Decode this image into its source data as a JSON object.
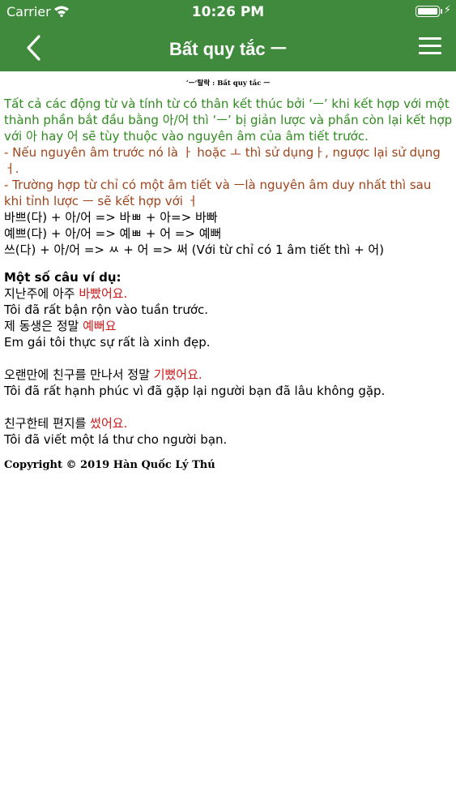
{
  "status_bar": {
    "carrier": "Carrier",
    "time": "10:26 PM"
  },
  "nav_bar": {
    "title": "Bất quy tắc ㅡ"
  },
  "content": {
    "doc_title": "‘ㅡ’탈락 : Bất quy tắc ㅡ",
    "intro_lines": [
      "Tất cả các động từ và tính từ có thân kết thúc bởi ‘ㅡ’ khi kết hợp với một",
      "thành phần bắt đầu bằng 아/어 thì ‘ㅡ’ bị giản lược và phần còn lại kết hợp",
      "với 아 hay 어 sẽ tùy thuộc vào nguyên âm của âm tiết trước."
    ],
    "rule_lines": [
      "- Nếu nguyên âm trước nó là ㅏ hoặc ㅗ thì sử dụngㅏ, ngược lại sử dụng",
      "ㅓ.",
      "- Trường hợp từ chỉ có một âm tiết và ㅡlà nguyên âm duy nhất thì sau",
      "khi tỉnh lược ㅡ sẽ kết hợp với ㅓ"
    ],
    "example_lines": [
      "바쁘(다) + 아/어 => 바ㅃ + 아=> 바빠",
      "예쁘(다) + 아/어 => 예ㅃ + 어 => 예뻐",
      "쓰(다) + 아/어 => ㅆ + 어 => 써 (Với từ chỉ có 1 âm tiết thì + 어)"
    ],
    "examples_heading": "Một số câu ví dụ:",
    "sentences": [
      {
        "ko_plain": "지난주에 아주 ",
        "ko_red": "바빴어요.",
        "vi": "Tôi đã rất bận rộn vào tuần trước."
      },
      {
        "ko_plain": "제 동생은 정말 ",
        "ko_red": "예뻐요",
        "vi": "Em gái tôi thực sự rất là xinh đẹp."
      },
      {
        "ko_plain": "오랜만에 친구를 만나서 정말 ",
        "ko_red": "기뻤어요.",
        "vi": "Tôi đã rất hạnh phúc vì đã gặp lại người bạn đã lâu không gặp."
      },
      {
        "ko_plain": "친구한테 편지를 ",
        "ko_red": "썼어요.",
        "vi": "Tôi đã viết một lá thư cho người bạn."
      }
    ],
    "copyright": "Copyright © 2019 Hàn Quốc Lý Thú"
  },
  "colors": {
    "header": "#3f8a3d",
    "intro_text": "#2e8b1e",
    "rule_text": "#a0431a",
    "highlight": "#d01818"
  },
  "icons": {
    "wifi": "wifi-icon",
    "battery": "battery-icon",
    "charging": "charging-bolt-icon",
    "back": "chevron-left-icon",
    "menu": "hamburger-menu-icon"
  }
}
